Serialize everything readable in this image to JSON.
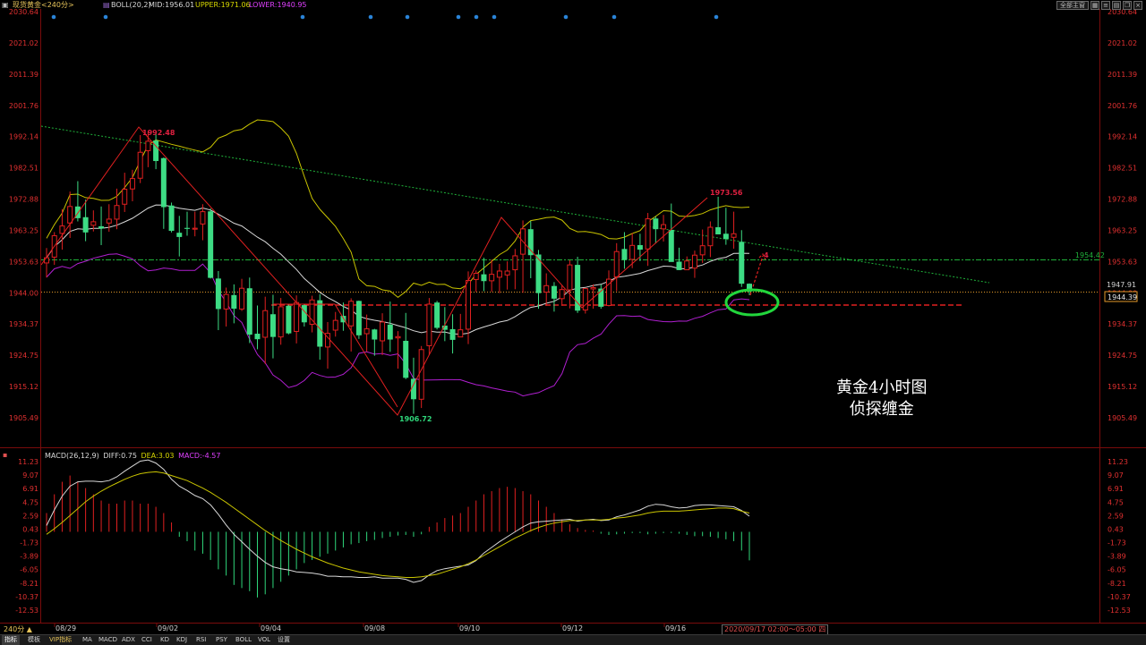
{
  "header": {
    "symbol": "现货黄金<240分>",
    "boll_label": "BOLL(20,2)",
    "mid": "MID:1956.01",
    "upper": "UPPER:1971.06",
    "lower": "LOWER:1940.95",
    "layout_button": "全部主窗",
    "colors": {
      "symbol": "#e6c45a",
      "mid": "#d8d8d8",
      "upper": "#d7d700",
      "lower": "#e040ff"
    }
  },
  "price_axis": {
    "labels": [
      "2030.64",
      "2021.02",
      "2011.39",
      "2001.76",
      "1992.14",
      "1982.51",
      "1972.88",
      "1963.25",
      "1953.63",
      "1944.00",
      "1934.37",
      "1924.75",
      "1915.12",
      "1905.49"
    ],
    "min_value": 1905.49,
    "max_value": 2030.64,
    "current_price": "1944.39",
    "level_1954": "1954.42",
    "level_1947": "1947.91"
  },
  "macd_panel": {
    "legend": {
      "name": "MACD(26,12,9)",
      "diff": "DIFF:0.75",
      "dea": "DEA:3.03",
      "macd": "MACD:-4.57"
    },
    "axis_labels": [
      "11.23",
      "9.07",
      "6.91",
      "4.75",
      "2.59",
      "0.43",
      "-1.73",
      "-3.89",
      "-6.05",
      "-8.21",
      "-10.37",
      "-12.53"
    ],
    "min_value": -12.53,
    "max_value": 11.23
  },
  "annotations": {
    "peak_label": "1992.48",
    "low_label": "1906.72",
    "recent_high_label": "1973.56",
    "arrow_count": "4",
    "title_line1": "黄金4小时图",
    "title_line2": "侦探缠金"
  },
  "time_axis": {
    "labels": [
      "08/29",
      "09/02",
      "09/04",
      "09/08",
      "09/10",
      "09/12",
      "09/16"
    ],
    "cursor": "2020/09/17 02:00～05:00 四"
  },
  "period_selector": "240分 ▲",
  "bottom_tabs": [
    "指标",
    "模板",
    "VIP指标",
    "MA",
    "MACD",
    "ADX",
    "CCI",
    "KD",
    "KDJ",
    "RSI",
    "PSY",
    "BOLL",
    "VOL",
    "设置"
  ],
  "chart_data": {
    "type": "candlestick",
    "timeframe": "240分",
    "x_labels": [
      "08/29",
      "09/02",
      "09/04",
      "09/08",
      "09/10",
      "09/12",
      "09/16"
    ],
    "ylim": [
      1905.49,
      2030.64
    ],
    "candles": [
      {
        "o": 1953.2,
        "h": 1957.8,
        "l": 1948.7,
        "c": 1954.8
      },
      {
        "o": 1955.0,
        "h": 1962.7,
        "l": 1952.6,
        "c": 1961.6
      },
      {
        "o": 1962.3,
        "h": 1969.8,
        "l": 1957.3,
        "c": 1964.6
      },
      {
        "o": 1965.5,
        "h": 1975.2,
        "l": 1960.9,
        "c": 1970.6
      },
      {
        "o": 1970.6,
        "h": 1978.4,
        "l": 1966.0,
        "c": 1967.0
      },
      {
        "o": 1967.3,
        "h": 1972.7,
        "l": 1959.9,
        "c": 1962.6
      },
      {
        "o": 1964.8,
        "h": 1969.4,
        "l": 1962.9,
        "c": 1965.9
      },
      {
        "o": 1964.5,
        "h": 1970.6,
        "l": 1958.7,
        "c": 1963.8
      },
      {
        "o": 1965.5,
        "h": 1971.3,
        "l": 1962.8,
        "c": 1966.7
      },
      {
        "o": 1966.7,
        "h": 1976.1,
        "l": 1963.6,
        "c": 1970.9
      },
      {
        "o": 1971.3,
        "h": 1981.0,
        "l": 1968.9,
        "c": 1975.9
      },
      {
        "o": 1976.0,
        "h": 1981.9,
        "l": 1972.2,
        "c": 1979.2
      },
      {
        "o": 1979.3,
        "h": 1992.6,
        "l": 1977.8,
        "c": 1987.3
      },
      {
        "o": 1987.8,
        "h": 1993.8,
        "l": 1982.7,
        "c": 1990.7
      },
      {
        "o": 1990.9,
        "h": 1993.0,
        "l": 1982.1,
        "c": 1984.6
      },
      {
        "o": 1985.5,
        "h": 1985.7,
        "l": 1963.7,
        "c": 1970.4
      },
      {
        "o": 1970.9,
        "h": 1971.8,
        "l": 1962.6,
        "c": 1963.1
      },
      {
        "o": 1962.5,
        "h": 1967.7,
        "l": 1955.2,
        "c": 1961.2
      },
      {
        "o": 1964.0,
        "h": 1969.0,
        "l": 1961.6,
        "c": 1963.7
      },
      {
        "o": 1963.6,
        "h": 1969.0,
        "l": 1961.4,
        "c": 1963.9
      },
      {
        "o": 1965.2,
        "h": 1971.3,
        "l": 1960.2,
        "c": 1969.0
      },
      {
        "o": 1969.1,
        "h": 1970.0,
        "l": 1948.4,
        "c": 1948.6
      },
      {
        "o": 1948.4,
        "h": 1950.7,
        "l": 1932.5,
        "c": 1939.0
      },
      {
        "o": 1939.0,
        "h": 1945.6,
        "l": 1933.6,
        "c": 1943.5
      },
      {
        "o": 1943.3,
        "h": 1946.6,
        "l": 1934.6,
        "c": 1939.1
      },
      {
        "o": 1939.0,
        "h": 1948.3,
        "l": 1938.4,
        "c": 1945.4
      },
      {
        "o": 1945.4,
        "h": 1948.7,
        "l": 1928.5,
        "c": 1931.1
      },
      {
        "o": 1931.4,
        "h": 1940.1,
        "l": 1926.6,
        "c": 1929.7
      },
      {
        "o": 1930.3,
        "h": 1942.8,
        "l": 1922.1,
        "c": 1938.5
      },
      {
        "o": 1937.4,
        "h": 1943.4,
        "l": 1923.8,
        "c": 1930.4
      },
      {
        "o": 1930.4,
        "h": 1942.4,
        "l": 1928.0,
        "c": 1939.7
      },
      {
        "o": 1940.0,
        "h": 1940.5,
        "l": 1931.2,
        "c": 1931.5
      },
      {
        "o": 1932.1,
        "h": 1943.2,
        "l": 1928.4,
        "c": 1941.0
      },
      {
        "o": 1940.2,
        "h": 1940.6,
        "l": 1933.6,
        "c": 1934.9
      },
      {
        "o": 1934.3,
        "h": 1943.1,
        "l": 1931.8,
        "c": 1941.8
      },
      {
        "o": 1941.7,
        "h": 1943.6,
        "l": 1923.4,
        "c": 1927.4
      },
      {
        "o": 1927.3,
        "h": 1935.0,
        "l": 1920.6,
        "c": 1931.5
      },
      {
        "o": 1932.5,
        "h": 1938.1,
        "l": 1930.5,
        "c": 1935.5
      },
      {
        "o": 1936.9,
        "h": 1941.0,
        "l": 1932.3,
        "c": 1934.9
      },
      {
        "o": 1933.8,
        "h": 1942.3,
        "l": 1925.9,
        "c": 1941.4
      },
      {
        "o": 1941.5,
        "h": 1941.6,
        "l": 1929.8,
        "c": 1930.9
      },
      {
        "o": 1931.4,
        "h": 1937.3,
        "l": 1925.8,
        "c": 1932.9
      },
      {
        "o": 1932.7,
        "h": 1932.9,
        "l": 1924.6,
        "c": 1929.6
      },
      {
        "o": 1929.2,
        "h": 1937.7,
        "l": 1924.8,
        "c": 1935.0
      },
      {
        "o": 1934.2,
        "h": 1941.3,
        "l": 1925.8,
        "c": 1929.6
      },
      {
        "o": 1930.1,
        "h": 1932.2,
        "l": 1920.6,
        "c": 1930.5
      },
      {
        "o": 1929.2,
        "h": 1937.8,
        "l": 1917.4,
        "c": 1917.8
      },
      {
        "o": 1917.5,
        "h": 1924.0,
        "l": 1906.7,
        "c": 1911.2
      },
      {
        "o": 1911.2,
        "h": 1927.6,
        "l": 1908.5,
        "c": 1926.5
      },
      {
        "o": 1927.7,
        "h": 1942.4,
        "l": 1924.8,
        "c": 1940.5
      },
      {
        "o": 1941.0,
        "h": 1941.5,
        "l": 1932.7,
        "c": 1933.2
      },
      {
        "o": 1933.9,
        "h": 1939.6,
        "l": 1929.1,
        "c": 1932.6
      },
      {
        "o": 1932.8,
        "h": 1937.4,
        "l": 1925.3,
        "c": 1929.5
      },
      {
        "o": 1930.4,
        "h": 1937.5,
        "l": 1930.3,
        "c": 1932.6
      },
      {
        "o": 1932.8,
        "h": 1950.6,
        "l": 1928.2,
        "c": 1947.8
      },
      {
        "o": 1948.1,
        "h": 1950.9,
        "l": 1944.3,
        "c": 1950.0
      },
      {
        "o": 1949.7,
        "h": 1954.8,
        "l": 1944.5,
        "c": 1947.6
      },
      {
        "o": 1947.7,
        "h": 1954.3,
        "l": 1944.3,
        "c": 1949.7
      },
      {
        "o": 1948.8,
        "h": 1952.9,
        "l": 1943.9,
        "c": 1950.7
      },
      {
        "o": 1949.5,
        "h": 1953.7,
        "l": 1945.0,
        "c": 1950.7
      },
      {
        "o": 1951.1,
        "h": 1957.5,
        "l": 1945.1,
        "c": 1955.4
      },
      {
        "o": 1955.9,
        "h": 1966.3,
        "l": 1944.0,
        "c": 1963.7
      },
      {
        "o": 1963.6,
        "h": 1966.1,
        "l": 1948.5,
        "c": 1955.6
      },
      {
        "o": 1955.8,
        "h": 1957.2,
        "l": 1939.1,
        "c": 1943.9
      },
      {
        "o": 1944.2,
        "h": 1950.0,
        "l": 1940.0,
        "c": 1946.2
      },
      {
        "o": 1946.1,
        "h": 1947.3,
        "l": 1938.2,
        "c": 1942.2
      },
      {
        "o": 1942.2,
        "h": 1946.4,
        "l": 1940.0,
        "c": 1945.0
      },
      {
        "o": 1944.9,
        "h": 1954.1,
        "l": 1939.2,
        "c": 1952.6
      },
      {
        "o": 1952.6,
        "h": 1955.1,
        "l": 1937.8,
        "c": 1938.5
      },
      {
        "o": 1938.7,
        "h": 1945.5,
        "l": 1937.6,
        "c": 1945.3
      },
      {
        "o": 1945.2,
        "h": 1946.6,
        "l": 1939.1,
        "c": 1945.6
      },
      {
        "o": 1945.3,
        "h": 1946.6,
        "l": 1939.1,
        "c": 1939.7
      },
      {
        "o": 1940.1,
        "h": 1950.9,
        "l": 1939.8,
        "c": 1948.2
      },
      {
        "o": 1948.9,
        "h": 1959.3,
        "l": 1944.5,
        "c": 1956.7
      },
      {
        "o": 1957.5,
        "h": 1962.7,
        "l": 1951.4,
        "c": 1954.2
      },
      {
        "o": 1954.3,
        "h": 1962.4,
        "l": 1951.6,
        "c": 1958.6
      },
      {
        "o": 1958.7,
        "h": 1962.2,
        "l": 1953.8,
        "c": 1957.3
      },
      {
        "o": 1957.5,
        "h": 1968.6,
        "l": 1952.3,
        "c": 1966.8
      },
      {
        "o": 1966.9,
        "h": 1967.5,
        "l": 1959.2,
        "c": 1963.6
      },
      {
        "o": 1963.7,
        "h": 1968.0,
        "l": 1959.8,
        "c": 1965.0
      },
      {
        "o": 1963.4,
        "h": 1971.5,
        "l": 1960.3,
        "c": 1953.5
      },
      {
        "o": 1953.6,
        "h": 1957.9,
        "l": 1951.0,
        "c": 1951.0
      },
      {
        "o": 1951.1,
        "h": 1955.2,
        "l": 1951.3,
        "c": 1953.8
      },
      {
        "o": 1951.6,
        "h": 1957.0,
        "l": 1948.6,
        "c": 1955.6
      },
      {
        "o": 1955.7,
        "h": 1963.5,
        "l": 1953.2,
        "c": 1958.5
      },
      {
        "o": 1958.5,
        "h": 1966.0,
        "l": 1955.0,
        "c": 1964.2
      },
      {
        "o": 1964.2,
        "h": 1973.6,
        "l": 1962.1,
        "c": 1962.0
      },
      {
        "o": 1962.2,
        "h": 1970.2,
        "l": 1958.8,
        "c": 1960.6
      },
      {
        "o": 1961.1,
        "h": 1969.0,
        "l": 1957.6,
        "c": 1962.2
      },
      {
        "o": 1959.7,
        "h": 1963.3,
        "l": 1945.8,
        "c": 1946.8
      },
      {
        "o": 1946.8,
        "h": 1946.9,
        "l": 1943.3,
        "c": 1944.4
      }
    ],
    "overlay_lines": [
      {
        "name": "MID",
        "value": 1956.01
      },
      {
        "name": "UPPER",
        "value": 1971.06
      },
      {
        "name": "LOWER",
        "value": 1940.95
      }
    ],
    "price_levels": [
      1954.42,
      1947.91,
      1944.39
    ],
    "macd": {
      "ylim": [
        -12.53,
        11.23
      ],
      "diff": [
        1.0,
        3.5,
        5.7,
        7.3,
        8.0,
        8.1,
        8.1,
        8.0,
        8.2,
        8.8,
        9.7,
        10.5,
        11.3,
        11.5,
        11.0,
        10.0,
        8.4,
        7.3,
        6.6,
        5.8,
        5.3,
        4.3,
        2.8,
        1.1,
        -0.4,
        -1.6,
        -2.8,
        -3.9,
        -4.9,
        -5.6,
        -5.9,
        -6.1,
        -6.4,
        -6.5,
        -6.6,
        -6.8,
        -7.1,
        -7.1,
        -7.2,
        -7.2,
        -7.3,
        -7.3,
        -7.2,
        -7.4,
        -7.4,
        -7.4,
        -7.6,
        -8.1,
        -7.8,
        -6.9,
        -6.2,
        -5.9,
        -5.7,
        -5.5,
        -5.3,
        -4.6,
        -3.4,
        -2.5,
        -1.6,
        -0.8,
        0.0,
        0.8,
        1.4,
        1.6,
        1.7,
        1.8,
        1.9,
        2.0,
        1.7,
        1.9,
        2.0,
        1.8,
        1.9,
        2.4,
        2.7,
        3.1,
        3.5,
        4.1,
        4.4,
        4.3,
        4.0,
        3.8,
        3.9,
        4.2,
        4.3,
        4.3,
        4.2,
        4.1,
        4.0,
        3.4,
        2.5
      ],
      "dea": [
        -0.4,
        0.5,
        1.5,
        2.6,
        3.7,
        4.8,
        5.7,
        6.5,
        7.2,
        7.8,
        8.4,
        8.9,
        9.3,
        9.5,
        9.6,
        9.4,
        9.0,
        8.6,
        8.2,
        7.6,
        7.0,
        6.3,
        5.5,
        4.7,
        3.8,
        2.9,
        2.0,
        1.1,
        0.2,
        -0.6,
        -1.4,
        -2.1,
        -2.8,
        -3.4,
        -4.0,
        -4.5,
        -5.0,
        -5.4,
        -5.8,
        -6.1,
        -6.4,
        -6.6,
        -6.8,
        -7.0,
        -7.1,
        -7.2,
        -7.3,
        -7.3,
        -7.2,
        -7.0,
        -6.8,
        -6.4,
        -6.0,
        -5.6,
        -5.1,
        -4.5,
        -3.8,
        -3.1,
        -2.4,
        -1.7,
        -1.0,
        -0.4,
        0.2,
        0.7,
        1.1,
        1.4,
        1.6,
        1.8,
        1.8,
        1.9,
        1.9,
        1.9,
        2.0,
        2.2,
        2.3,
        2.5,
        2.7,
        3.0,
        3.2,
        3.3,
        3.3,
        3.3,
        3.4,
        3.5,
        3.6,
        3.7,
        3.8,
        3.8,
        3.7,
        3.3,
        3.0
      ],
      "hist": [
        3.0,
        6.0,
        8.0,
        9.0,
        8.0,
        7.0,
        6.0,
        5.0,
        4.5,
        4.5,
        5.0,
        5.0,
        4.5,
        4.5,
        4.0,
        3.0,
        1.5,
        -0.8,
        -1.5,
        -3.0,
        -3.5,
        -4.5,
        -6.0,
        -7.0,
        -8.5,
        -9.0,
        -9.5,
        -10.5,
        -10.0,
        -9.0,
        -8.0,
        -7.0,
        -6.0,
        -5.0,
        -4.5,
        -4.0,
        -3.5,
        -3.0,
        -2.5,
        -2.0,
        -1.8,
        -1.5,
        -1.3,
        -1.0,
        -0.8,
        -0.6,
        -0.5,
        -0.8,
        -0.4,
        0.8,
        1.5,
        2.2,
        2.6,
        3.0,
        4.0,
        5.0,
        6.0,
        6.5,
        7.0,
        7.2,
        7.0,
        6.5,
        6.0,
        5.0,
        4.0,
        3.0,
        2.0,
        1.2,
        0.6,
        0.3,
        0.2,
        -0.3,
        -0.5,
        -0.4,
        -0.3,
        -0.2,
        -0.2,
        -0.4,
        -0.3,
        -0.2,
        -0.2,
        -0.3,
        -0.5,
        -0.7,
        -0.7,
        -0.8,
        -1.0,
        -1.2,
        -1.5,
        -3.0,
        -4.57
      ]
    }
  }
}
